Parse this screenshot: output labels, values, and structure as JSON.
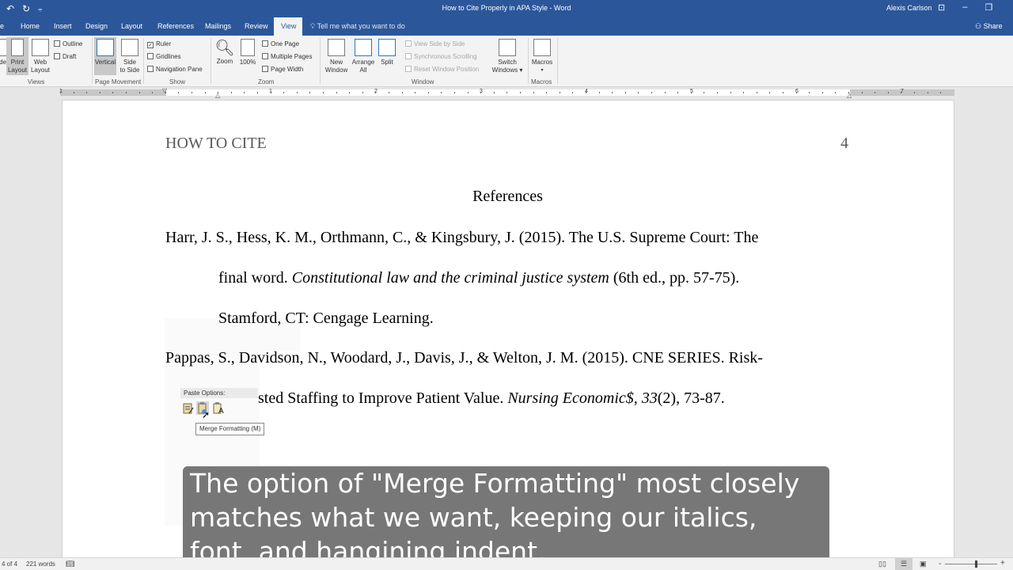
{
  "titlebar": {
    "title": "How to Cite Properly in APA Style  -  Word",
    "user": "Alexis Carlson",
    "undo": "↶",
    "redo": "↻",
    "customize": "⩦"
  },
  "tabs": [
    {
      "label": "Home"
    },
    {
      "label": "Insert"
    },
    {
      "label": "Design"
    },
    {
      "label": "Layout"
    },
    {
      "label": "References"
    },
    {
      "label": "Mailings"
    },
    {
      "label": "Review"
    },
    {
      "label": "View"
    }
  ],
  "tell_me": "Tell me what you want to do",
  "share": "Share",
  "ribbon": {
    "views": {
      "label": "Views",
      "read_mode": "Mode",
      "print_layout": [
        "Print",
        "Layout"
      ],
      "web_layout": [
        "Web",
        "Layout"
      ],
      "outline": "Outline",
      "draft": "Draft"
    },
    "page_movement": {
      "label": "Page Movement",
      "vertical": "Vertical",
      "side_to_side": [
        "Side",
        "to Side"
      ]
    },
    "show": {
      "label": "Show",
      "ruler": "Ruler",
      "ruler_checked": true,
      "gridlines": "Gridlines",
      "gridlines_checked": false,
      "nav_pane": "Navigation Pane",
      "nav_pane_checked": false
    },
    "zoom": {
      "label": "Zoom",
      "zoom": "Zoom",
      "hundred": "100%",
      "one_page": "One Page",
      "multiple_pages": "Multiple Pages",
      "page_width": "Page Width"
    },
    "window": {
      "label": "Window",
      "new_window": [
        "New",
        "Window"
      ],
      "arrange_all": [
        "Arrange",
        "All"
      ],
      "split": "Split",
      "view_side_by_side": "View Side by Side",
      "sync_scrolling": "Synchronous Scrolling",
      "reset_position": "Reset Window Position",
      "switch_windows": [
        "Switch",
        "Windows ▾"
      ]
    },
    "macros": {
      "label": "Macros",
      "macros": "Macros",
      "arrow": "▾"
    }
  },
  "ruler": {
    "numbers": [
      "1",
      "1",
      "2",
      "3",
      "4",
      "5",
      "6",
      "7"
    ]
  },
  "document": {
    "header": "HOW TO CITE",
    "page_number": "4",
    "references_title": "References",
    "ref1": {
      "line1": "Harr, J. S., Hess, K. M., Orthmann, C., & Kingsbury, J. (2015). The U.S. Supreme Court: The",
      "line2_pre": "final word. ",
      "line2_italic": "Constitutional law and the criminal justice system",
      "line2_post": " (6th ed., pp. 57-75).",
      "line3": "Stamford, CT: Cengage Learning."
    },
    "ref2": {
      "line1": "Pappas, S., Davidson, N., Woodard, J., Davis, J., & Welton, J. M. (2015). CNE SERIES. Risk-",
      "line2_pre": "sted Staffing to Improve Patient Value. ",
      "line2_italic": "Nursing Economic$",
      "line2_mid": ", ",
      "line2_italic2": "33",
      "line2_post": "(2), 73-87."
    }
  },
  "paste_options": {
    "title": "Paste Options:",
    "tooltip": "Merge Formatting (M)"
  },
  "caption": "The option of \"Merge Formatting\" most closely matches what we want, keeping our italics, font, and hangining indent.",
  "status": {
    "page": "4 of 4",
    "words": "221 words",
    "zoom_minus": "-",
    "zoom_plus": "+"
  }
}
